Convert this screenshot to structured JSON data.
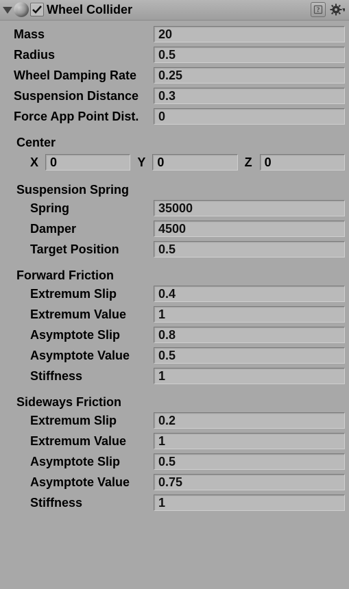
{
  "header": {
    "title": "Wheel Collider",
    "enabled": true
  },
  "props": {
    "mass_label": "Mass",
    "mass": "20",
    "radius_label": "Radius",
    "radius": "0.5",
    "damping_label": "Wheel Damping Rate",
    "damping": "0.25",
    "susp_dist_label": "Suspension Distance",
    "susp_dist": "0.3",
    "fapd_label": "Force App Point Dist.",
    "fapd": "0"
  },
  "center": {
    "label": "Center",
    "xlabel": "X",
    "x": "0",
    "ylabel": "Y",
    "y": "0",
    "zlabel": "Z",
    "z": "0"
  },
  "spring": {
    "label": "Suspension Spring",
    "spring_label": "Spring",
    "spring": "35000",
    "damper_label": "Damper",
    "damper": "4500",
    "target_label": "Target Position",
    "target": "0.5"
  },
  "fwd": {
    "label": "Forward Friction",
    "exslip_label": "Extremum Slip",
    "exslip": "0.4",
    "exval_label": "Extremum Value",
    "exval": "1",
    "asslip_label": "Asymptote Slip",
    "asslip": "0.8",
    "asval_label": "Asymptote Value",
    "asval": "0.5",
    "stiff_label": "Stiffness",
    "stiff": "1"
  },
  "side": {
    "label": "Sideways Friction",
    "exslip_label": "Extremum Slip",
    "exslip": "0.2",
    "exval_label": "Extremum Value",
    "exval": "1",
    "asslip_label": "Asymptote Slip",
    "asslip": "0.5",
    "asval_label": "Asymptote Value",
    "asval": "0.75",
    "stiff_label": "Stiffness",
    "stiff": "1"
  }
}
